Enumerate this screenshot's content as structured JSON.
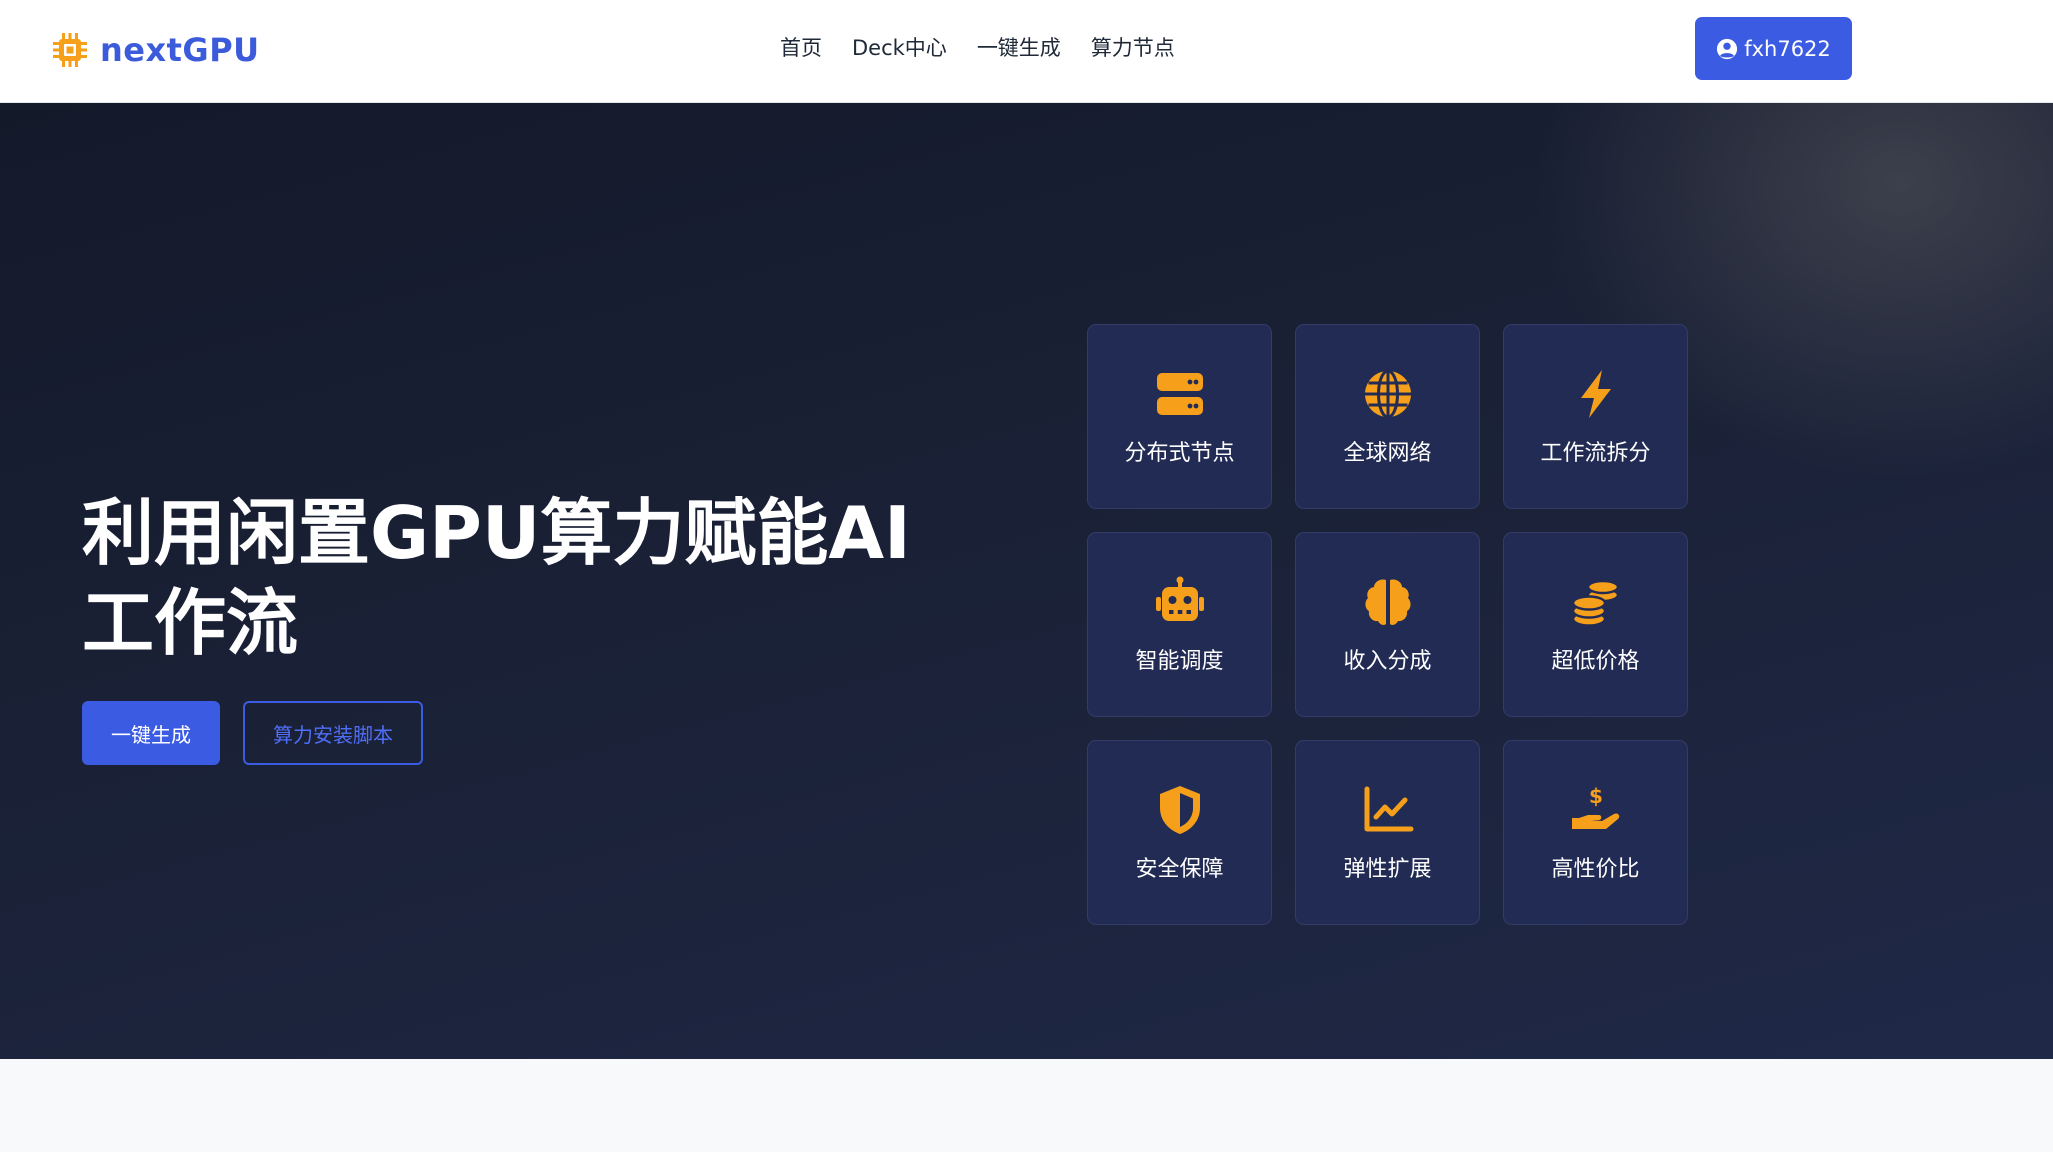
{
  "brand": {
    "name": "nextGPU",
    "color": "#3b5bdb",
    "icon": "cpu-icon",
    "icon_color": "#f59f1b"
  },
  "nav": {
    "links": [
      "首页",
      "Deck中心",
      "一键生成",
      "算力节点"
    ]
  },
  "user": {
    "label": "fxh7622",
    "icon": "user-circle-icon"
  },
  "hero": {
    "title_line1": "利用闲置GPU算力赋能AI",
    "title_line2": "工作流",
    "primary_button": "一键生成",
    "secondary_button": "算力安装脚本"
  },
  "features": [
    {
      "label": "分布式节点",
      "icon": "server-icon"
    },
    {
      "label": "全球网络",
      "icon": "globe-icon"
    },
    {
      "label": "工作流拆分",
      "icon": "bolt-icon"
    },
    {
      "label": "智能调度",
      "icon": "robot-icon"
    },
    {
      "label": "收入分成",
      "icon": "brain-icon"
    },
    {
      "label": "超低价格",
      "icon": "coins-icon"
    },
    {
      "label": "安全保障",
      "icon": "shield-icon"
    },
    {
      "label": "弹性扩展",
      "icon": "chart-line-icon"
    },
    {
      "label": "高性价比",
      "icon": "hand-dollar-icon"
    }
  ],
  "colors": {
    "accent": "#3b5be3",
    "icon": "#f59f1b",
    "hero_bg": "#1a2136",
    "card_bg": "#222b54"
  }
}
